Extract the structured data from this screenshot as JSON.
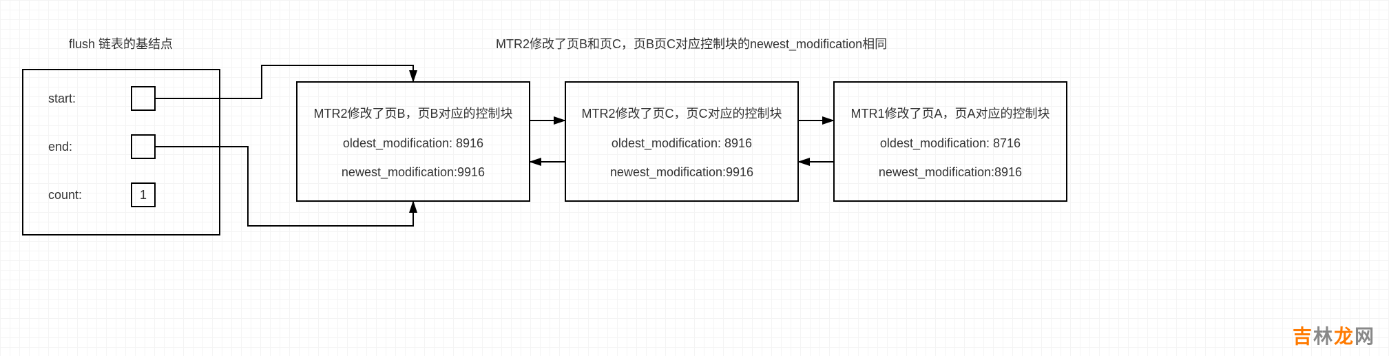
{
  "title": "flush 链表的基结点",
  "annotation": "MTR2修改了页B和页C，页B页C对应控制块的newest_modification相同",
  "base_node": {
    "start_label": "start:",
    "end_label": "end:",
    "count_label": "count:",
    "count_value": "1"
  },
  "block_b": {
    "title": "MTR2修改了页B，页B对应的控制块",
    "oldest": "oldest_modification: 8916",
    "newest": "newest_modification:9916"
  },
  "block_c": {
    "title": "MTR2修改了页C，页C对应的控制块",
    "oldest": "oldest_modification: 8916",
    "newest": "newest_modification:9916"
  },
  "block_a": {
    "title": "MTR1修改了页A，页A对应的控制块",
    "oldest": "oldest_modification: 8716",
    "newest": "newest_modification:8916"
  },
  "watermark": "吉林龙网"
}
